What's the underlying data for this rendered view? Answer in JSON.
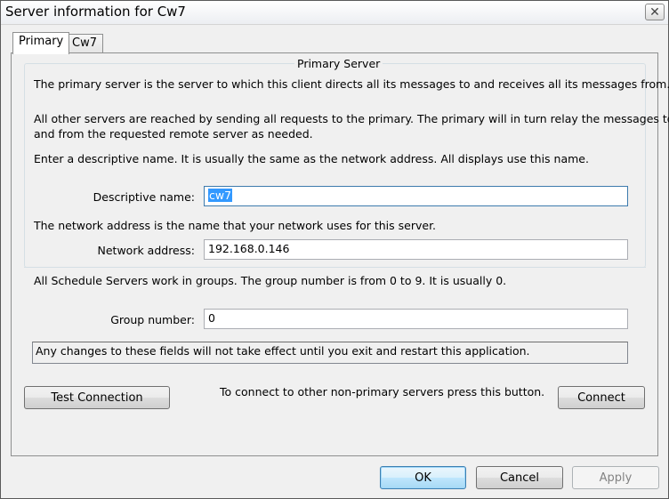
{
  "window": {
    "title": "Server information for Cw7",
    "close_glyph": "✕"
  },
  "tabs": [
    {
      "label": "Primary",
      "active": true
    },
    {
      "label": "Cw7",
      "active": false
    }
  ],
  "group": {
    "title": "Primary Server",
    "paragraph1": "The primary server is the server to which this client directs all its messages to and receives all its messages from.",
    "paragraph2_line1": "All other servers are reached by sending all requests to the primary.  The primary will in turn relay the messages to",
    "paragraph2_line2": "and from the requested remote server as needed.",
    "paragraph3": "Enter a descriptive name. It is usually the same as the network address.  All displays use this name.",
    "descriptive_name_label": "Descriptive name:",
    "descriptive_name_value": "cw7",
    "network_note": "The network address is the name that your network uses for this server.",
    "network_address_label": "Network address:",
    "network_address_value": "192.168.0.146"
  },
  "groups_note": "All Schedule Servers work in groups.  The group number is from 0 to 9.  It is usually 0.",
  "group_number_label": "Group number:",
  "group_number_value": "0",
  "notice": "Any changes to these fields will not take effect until you exit and restart this application.",
  "test_connection_label": "Test Connection",
  "connect_hint": "To connect to other non-primary servers press this button.",
  "connect_label": "Connect",
  "footer": {
    "ok_label": "OK",
    "cancel_label": "Cancel",
    "apply_label": "Apply"
  }
}
